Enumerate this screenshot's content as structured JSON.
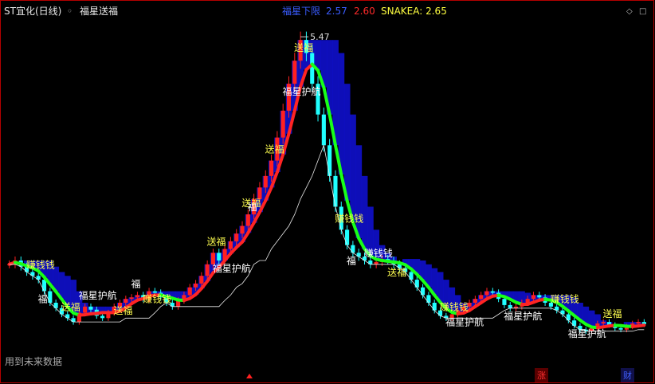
{
  "header": {
    "symbol": "ST宜化(日线)",
    "indicator": "福星送福",
    "band_label": "福星下限",
    "band_v1": "2.57",
    "band_v2": "2.60",
    "snake": "SNAKEA: 2.65"
  },
  "footer": {
    "note": "用到未来数据"
  },
  "markers": {
    "up_text": "涨",
    "fin_text": "财",
    "peak_label": "5.47"
  },
  "colors": {
    "bg": "#000000",
    "up": "#ff2020",
    "down": "#20ffff",
    "ma_green": "#18ff18",
    "ma_red": "#ff2424",
    "band_blue": "#1010d8",
    "label_yellow": "#ffff50",
    "label_white": "#ffffff",
    "frame": "#b40000"
  },
  "chart_data": {
    "type": "line",
    "title": "",
    "xlabel": "",
    "ylabel": "",
    "ylim": [
      1.2,
      5.7
    ],
    "peak_price": 5.47,
    "close": [
      2.55,
      2.6,
      2.52,
      2.45,
      2.4,
      2.35,
      2.2,
      2.05,
      1.98,
      1.9,
      1.85,
      1.8,
      1.92,
      2.0,
      1.96,
      1.88,
      1.85,
      1.92,
      2.0,
      2.05,
      2.1,
      2.12,
      2.15,
      2.1,
      2.2,
      2.18,
      2.12,
      2.05,
      2.0,
      2.08,
      2.15,
      2.25,
      2.3,
      2.4,
      2.55,
      2.7,
      2.6,
      2.75,
      2.85,
      2.95,
      3.05,
      3.2,
      3.4,
      3.55,
      3.7,
      3.9,
      4.2,
      4.55,
      4.9,
      5.2,
      5.47,
      5.3,
      4.9,
      4.5,
      4.1,
      3.7,
      3.3,
      3.0,
      2.8,
      2.7,
      2.65,
      2.6,
      2.55,
      2.58,
      2.62,
      2.6,
      2.55,
      2.5,
      2.45,
      2.35,
      2.25,
      2.15,
      2.05,
      1.95,
      1.88,
      1.85,
      1.9,
      1.95,
      2.0,
      2.05,
      2.1,
      2.15,
      2.2,
      2.18,
      2.1,
      2.02,
      1.98,
      2.0,
      2.05,
      2.1,
      2.15,
      2.12,
      2.05,
      2.0,
      1.95,
      1.9,
      1.82,
      1.75,
      1.7,
      1.68,
      1.72,
      1.78,
      1.8,
      1.76,
      1.72,
      1.7,
      1.74,
      1.78,
      1.8,
      1.77
    ],
    "labels": [
      {
        "text": "送福",
        "i": 50,
        "color": "label_yellow"
      },
      {
        "text": "送福",
        "i": 45,
        "color": "label_yellow"
      },
      {
        "text": "福星护航",
        "i": 48,
        "color": "label_white"
      },
      {
        "text": "送福",
        "i": 41,
        "color": "label_yellow"
      },
      {
        "text": "福",
        "i": 42,
        "color": "label_white"
      },
      {
        "text": "送福",
        "i": 35,
        "color": "label_yellow"
      },
      {
        "text": "福星护航",
        "i": 36,
        "color": "label_white"
      },
      {
        "text": "赚钱钱",
        "i": 57,
        "color": "label_yellow"
      },
      {
        "text": "福",
        "i": 59,
        "color": "label_white"
      },
      {
        "text": "赚钱钱",
        "i": 62,
        "color": "label_white"
      },
      {
        "text": "送福",
        "i": 66,
        "color": "label_yellow"
      },
      {
        "text": "赚钱钱",
        "i": 75,
        "color": "label_yellow"
      },
      {
        "text": "福星护航",
        "i": 76,
        "color": "label_white"
      },
      {
        "text": "送福",
        "i": 10,
        "color": "label_yellow"
      },
      {
        "text": "送福",
        "i": 19,
        "color": "label_yellow"
      },
      {
        "text": "赚钱钱",
        "i": 4,
        "color": "label_yellow"
      },
      {
        "text": "福",
        "i": 6,
        "color": "label_white"
      },
      {
        "text": "福",
        "i": 22,
        "color": "label_white"
      },
      {
        "text": "赚钱钱",
        "i": 24,
        "color": "label_yellow"
      },
      {
        "text": "福星护航",
        "i": 13,
        "color": "label_white"
      },
      {
        "text": "福星护航",
        "i": 97,
        "color": "label_white"
      },
      {
        "text": "送福",
        "i": 103,
        "color": "label_yellow"
      },
      {
        "text": "福星护航",
        "i": 86,
        "color": "label_white"
      },
      {
        "text": "赚钱钱",
        "i": 94,
        "color": "label_yellow"
      }
    ]
  }
}
